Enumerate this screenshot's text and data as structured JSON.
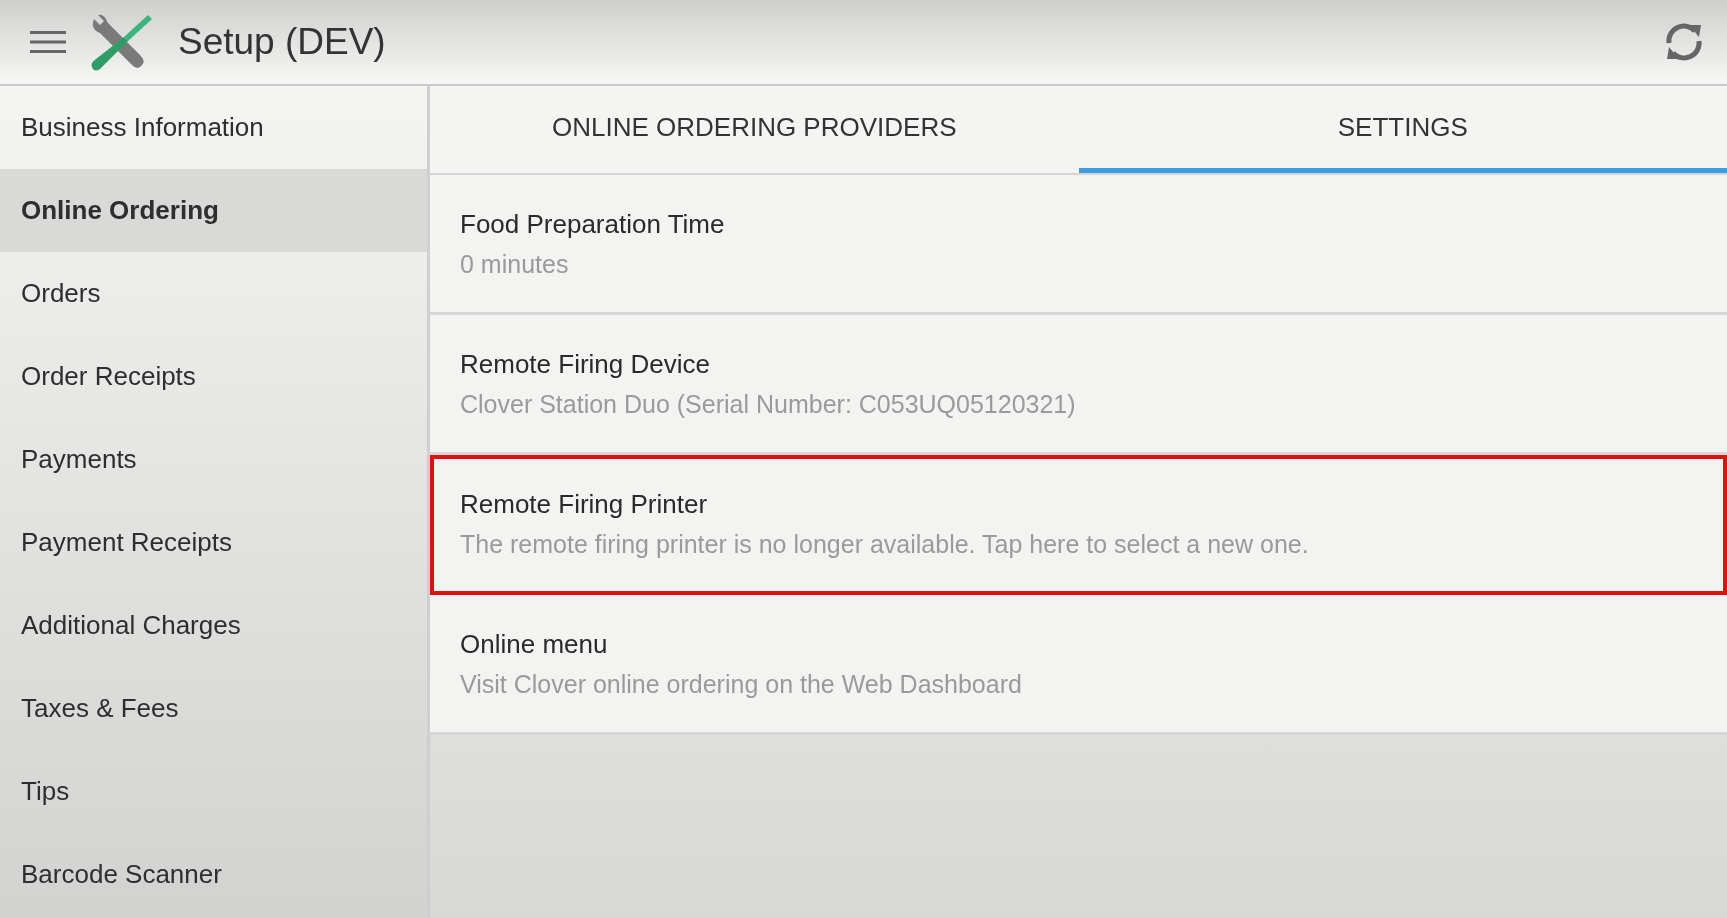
{
  "app_bar": {
    "title": "Setup (DEV)"
  },
  "sidebar": {
    "items": [
      {
        "label": "Business Information",
        "selected": false
      },
      {
        "label": "Online Ordering",
        "selected": true
      },
      {
        "label": "Orders",
        "selected": false
      },
      {
        "label": "Order Receipts",
        "selected": false
      },
      {
        "label": "Payments",
        "selected": false
      },
      {
        "label": "Payment Receipts",
        "selected": false
      },
      {
        "label": "Additional Charges",
        "selected": false
      },
      {
        "label": "Taxes & Fees",
        "selected": false
      },
      {
        "label": "Tips",
        "selected": false
      },
      {
        "label": "Barcode Scanner",
        "selected": false
      }
    ]
  },
  "tabs": [
    {
      "label": "ONLINE ORDERING PROVIDERS",
      "selected": false
    },
    {
      "label": "SETTINGS",
      "selected": true
    }
  ],
  "settings": [
    {
      "title": "Food Preparation Time",
      "subtitle": "0 minutes",
      "highlighted": false
    },
    {
      "title": "Remote Firing Device",
      "subtitle": "Clover Station Duo (Serial Number: C053UQ05120321)",
      "highlighted": false
    },
    {
      "title": "Remote Firing Printer",
      "subtitle": "The remote firing printer is no longer available. Tap here to select a new one.",
      "highlighted": true
    },
    {
      "title": "Online menu",
      "subtitle": "Visit Clover online ordering on the Web Dashboard",
      "highlighted": false
    }
  ]
}
